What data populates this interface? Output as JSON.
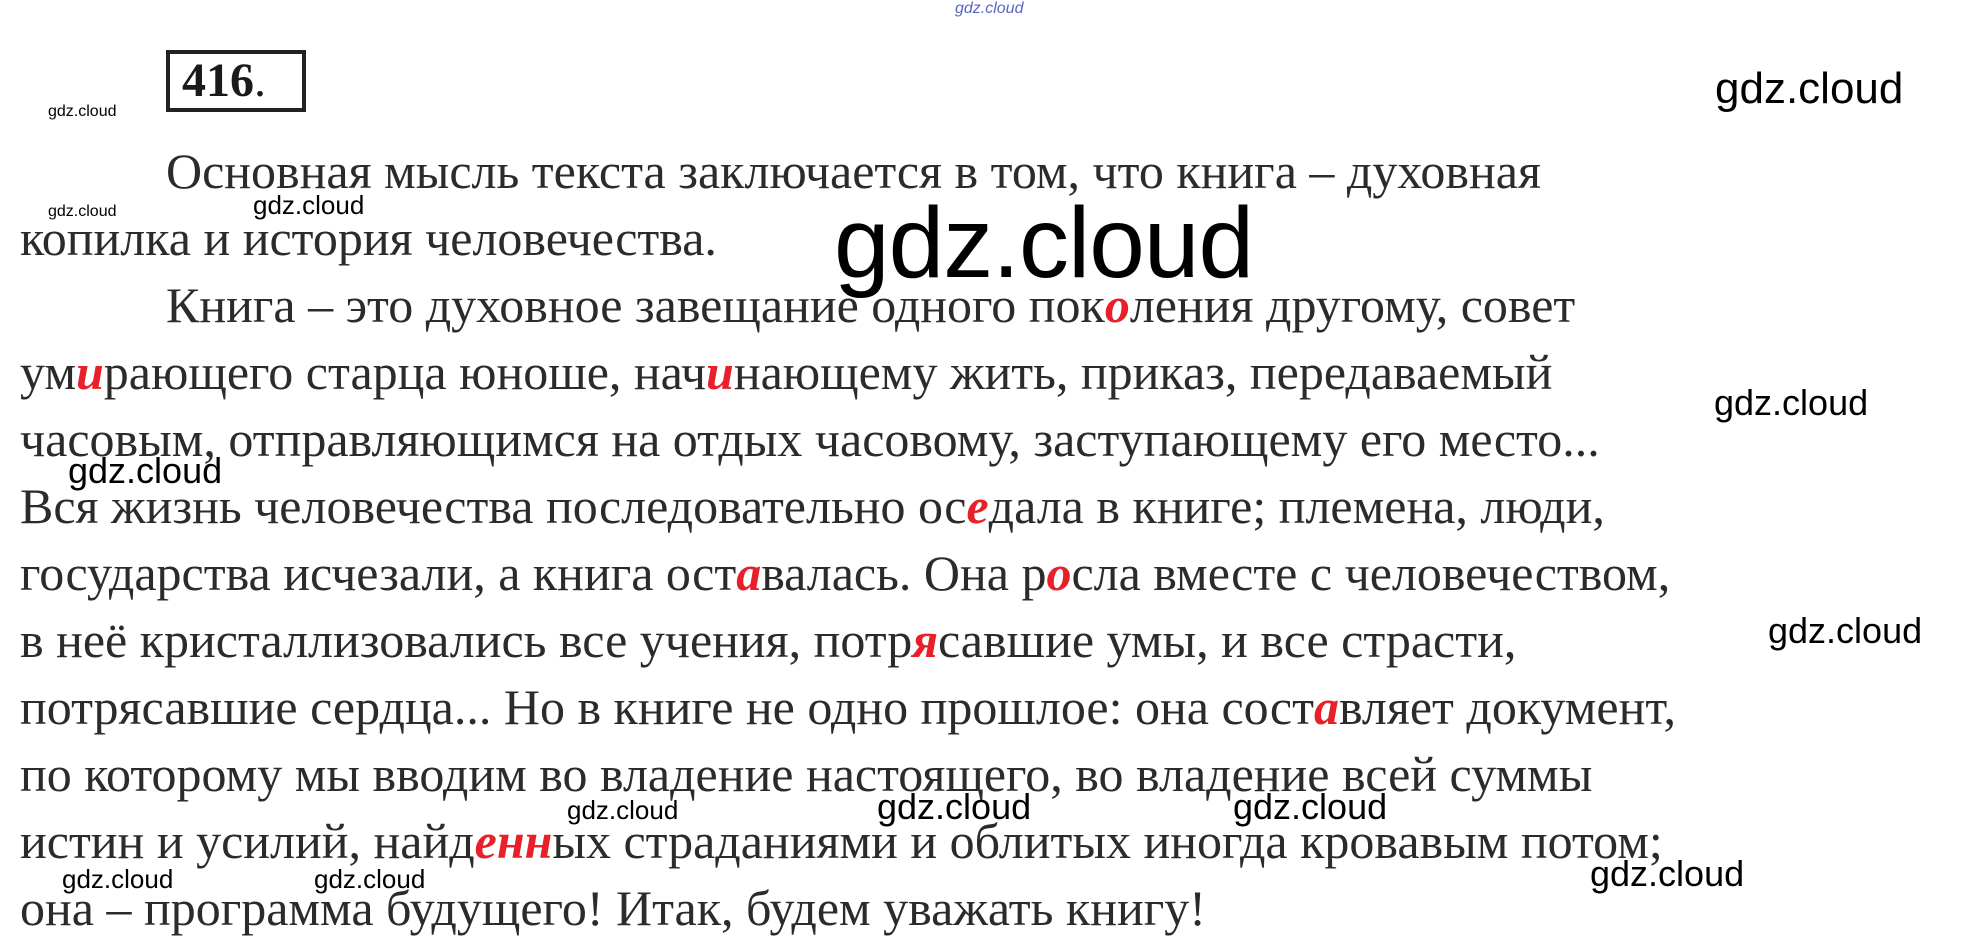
{
  "exercise": {
    "number": "416",
    "dot": "."
  },
  "paragraph1": {
    "line1": "Основная мысль текста заключается в том, что книга – духовная",
    "line2": "копилка и история человечества."
  },
  "paragraph2": {
    "l1a": "Книга – это духовное завещание одного пок",
    "l1r": "о",
    "l1b": "ления другому, совет",
    "l2a": "ум",
    "l2r": "и",
    "l2b": "рающего старца юноше, нач",
    "l2r2": "и",
    "l2c": "нающему жить, приказ, передаваемый",
    "l3": "часовым, отправляющимся на отдых часовому, заступающему его место...",
    "l4a": "Вся жизнь человечества последовательно ос",
    "l4r": "е",
    "l4b": "дала в книге; племена, люди,",
    "l5a": "государства исчезали, а книга ост",
    "l5r": "а",
    "l5b": "валась. Она р",
    "l5r2": "о",
    "l5c": "сла вместе с человечеством,",
    "l6a": "в неё кристаллизовались все учения, потр",
    "l6r": "я",
    "l6b": "савшие умы, и все страсти,",
    "l7a": "потрясавшие сердца... Но в книге не одно прошлое: она сост",
    "l7r": "а",
    "l7b": "вляет документ,",
    "l8": "по которому мы вводим во владение настоящего, во владение всей суммы",
    "l9a": "истин и усилий, найд",
    "l9r": "енн",
    "l9b": "ых страданиями и облитых иногда кровавым потом;",
    "l10": "она – программа будущего! Итак, будем уважать книгу!"
  },
  "watermark": "gdz.cloud",
  "colors": {
    "highlight": "#e8202a",
    "text": "#2b2b2b"
  }
}
